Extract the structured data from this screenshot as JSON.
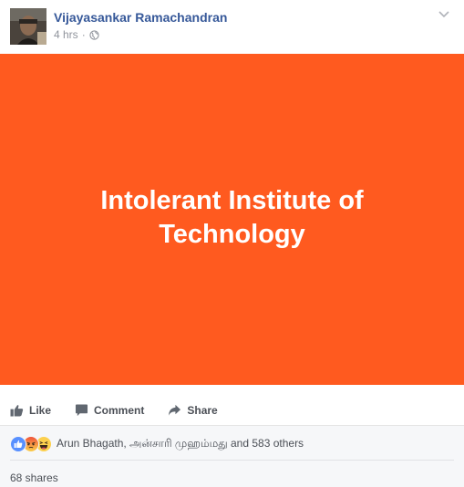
{
  "post": {
    "author": "Vijayasankar Ramachandran",
    "time": "4 hrs",
    "separator": "·",
    "banner_text": "Intolerant Institute of Technology",
    "banner_color": "#ff5a1f"
  },
  "actions": {
    "like": "Like",
    "comment": "Comment",
    "share": "Share"
  },
  "reactions": {
    "icons": [
      "like-icon",
      "angry-icon",
      "haha-icon"
    ],
    "text": "Arun Bhagath, அன்சாரி முஹம்மது and 583 others"
  },
  "shares": "68 shares",
  "colors": {
    "link": "#365899",
    "muted": "#90949c",
    "action_text": "#4b4f56",
    "like_blue": "#5890ff"
  }
}
